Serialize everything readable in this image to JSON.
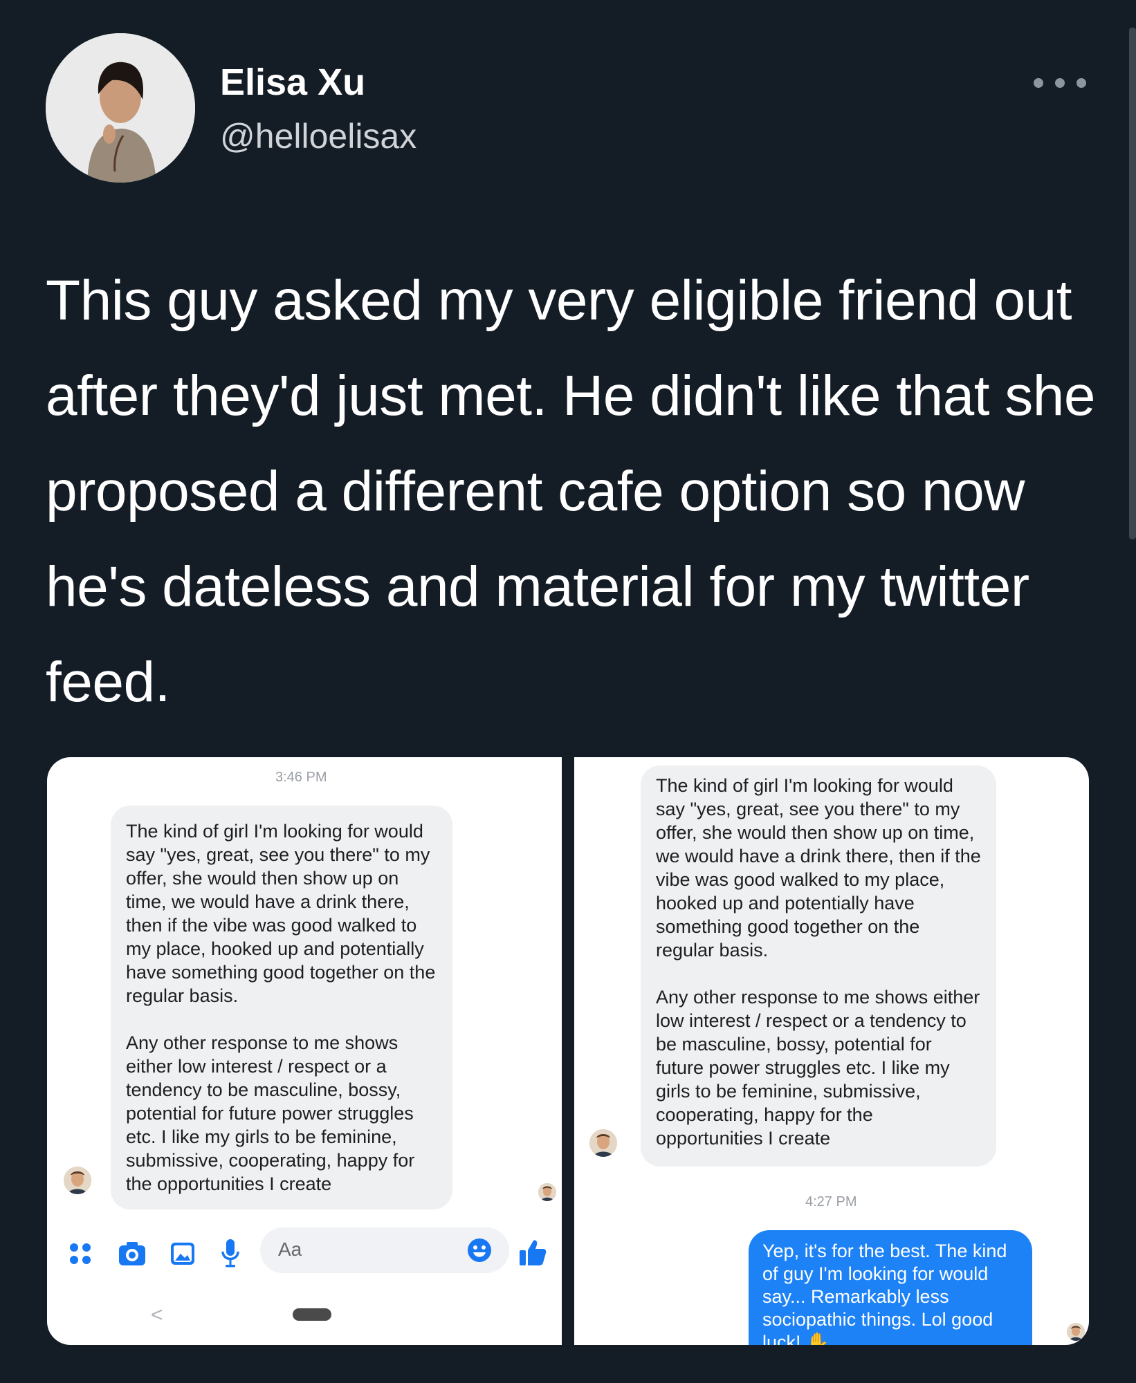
{
  "user": {
    "name": "Elisa Xu",
    "handle": "@helloelisax"
  },
  "tweet": {
    "text": "This guy asked my very eligible friend out after they'd just met. He didn't like that she proposed a different cafe option so now he's dateless and material for my twitter feed."
  },
  "screenshot_left": {
    "timestamp": "3:46 PM",
    "message": "The kind of girl I'm looking for would say \"yes, great, see you there\" to my offer, she would then show up on time, we would have a drink there, then if the vibe was good walked to my place, hooked up and potentially have something good together on the regular basis.\n\nAny other response to me shows either low interest / respect or a tendency to be masculine, bossy, potential for future power struggles etc. I like my girls to be feminine, submissive, cooperating, happy for the opportunities I create",
    "composer_placeholder": "Aa",
    "back_label": "<"
  },
  "screenshot_right": {
    "message": "The kind of girl I'm looking for would say \"yes, great, see you there\" to my offer, she would then show up on time, we would have a drink there, then if the vibe was good walked to my place, hooked up and potentially have something good together on the regular basis.\n\nAny other response to me shows either low interest / respect or a tendency to be masculine, bossy, potential for future power struggles etc. I like my girls to be feminine, submissive, cooperating, happy for the opportunities I create",
    "timestamp": "4:27 PM",
    "reply": "Yep, it's for the best. The kind of guy I'm looking for would say... Remarkably less sociopathic things. Lol good luck! ✋"
  },
  "colors": {
    "background": "#141d26",
    "messenger_blue": "#1e82f7",
    "bubble_gray": "#eff0f2"
  },
  "icons": [
    "more-icon",
    "apps-icon",
    "camera-icon",
    "gallery-icon",
    "microphone-icon",
    "emoji-icon",
    "like-icon"
  ]
}
